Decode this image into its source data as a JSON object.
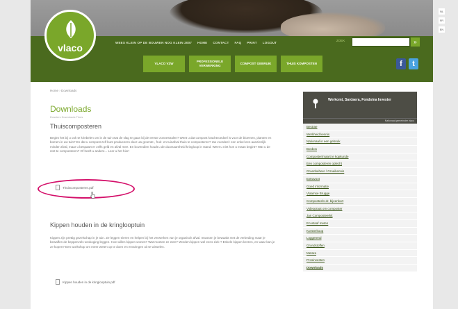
{
  "site": {
    "logo_text": "vlaco",
    "top_nav": [
      "WEES KLEIN OP DE BOUWEN NOG KLEIN 2007",
      "HOME",
      "CONTACT",
      "FAQ",
      "PRINT",
      "LOGOUT"
    ],
    "search": {
      "label": "ZOEK",
      "placeholder": "",
      "button": "»"
    },
    "main_nav": [
      {
        "label": "VLACO VZW"
      },
      {
        "label": "PROFESSIONELE VERWERKING"
      },
      {
        "label": "COMPOST GEBRUIK"
      },
      {
        "label": "THUIS KOMPOSTEN"
      }
    ],
    "social": [
      "f",
      "t"
    ],
    "side_tabs": [
      "NL",
      "FR",
      "EN"
    ]
  },
  "breadcrumb": "Home  ›  Downloads",
  "page_title": "Downloads",
  "subbreadcrumb": "Dossiers   Downloads   Thuis",
  "section1": {
    "title": "Thuiscomposteren",
    "text": "Begint het bij u ook te kriebelen om in de tuin wat de slag te gaan bij de eerste zonnestralen? Weet u dat compost krachtvoedsel is voor de bloemen, planten en bomen in uw tuin? En dat u compost zelf kunt produceren door uw groente-, fruit- en tuinafval thuis te composteren? Uw voordeel: een enkel een aanzienlijk minder afval, maar u bespaart er zelfs geld en afval mee. En bovendien houdt u de duurzaamheid kringloop in stand. Weet u niet hoe u eraan begint? Wat u de rest te composteren? Of heeft u andere... Leer u het hier!",
    "file": "Thuiscomposteren.pdf"
  },
  "section2": {
    "title": "Kippen houden in de kringlooptuin",
    "text": "Kippen zijn prettig gezelschap in je tuin. Ze leggen eieren en helpen bij het verwerken van je organisch afval. Intussen je bewaakt met de verbeding maar je bewaffen de keppenvels wrokoging krggen. Hoe willen kippen wonen? Wat moeten ze eten? Worden kippen wel eens ziek ? Enkele kippen kerzen, en waar kan je ze kopen? Een workshop om meer weten op te doen en ervaringen uit te wisselen.",
    "file": "Kippen houden in de kringlooptuin.pdf"
  },
  "sidebar": {
    "title": "Werkomt, Sardaera, Fondsina Invester",
    "subline": "Nationaal gemeinster vlaco",
    "items": [
      "Bestrae",
      "Werkheid kennis",
      "Nationaal in een gebruik",
      "Bosbos",
      "Composter/maart te kopkunde",
      "Een composteren oplecht",
      "Groenbeheer / Groeikennis",
      "Extravoot",
      "Goed informatie",
      "Vlaamse Brugge",
      "Composteels dr. bijeenkort",
      "Videopraat om composter",
      "Jan Composteerkit",
      "Ecostaaf meten",
      "Korsterkoop",
      "Loggerend",
      "Grondstoffen",
      "Metara",
      "Prosinvesten",
      "Downloads"
    ],
    "active_index": 19
  }
}
